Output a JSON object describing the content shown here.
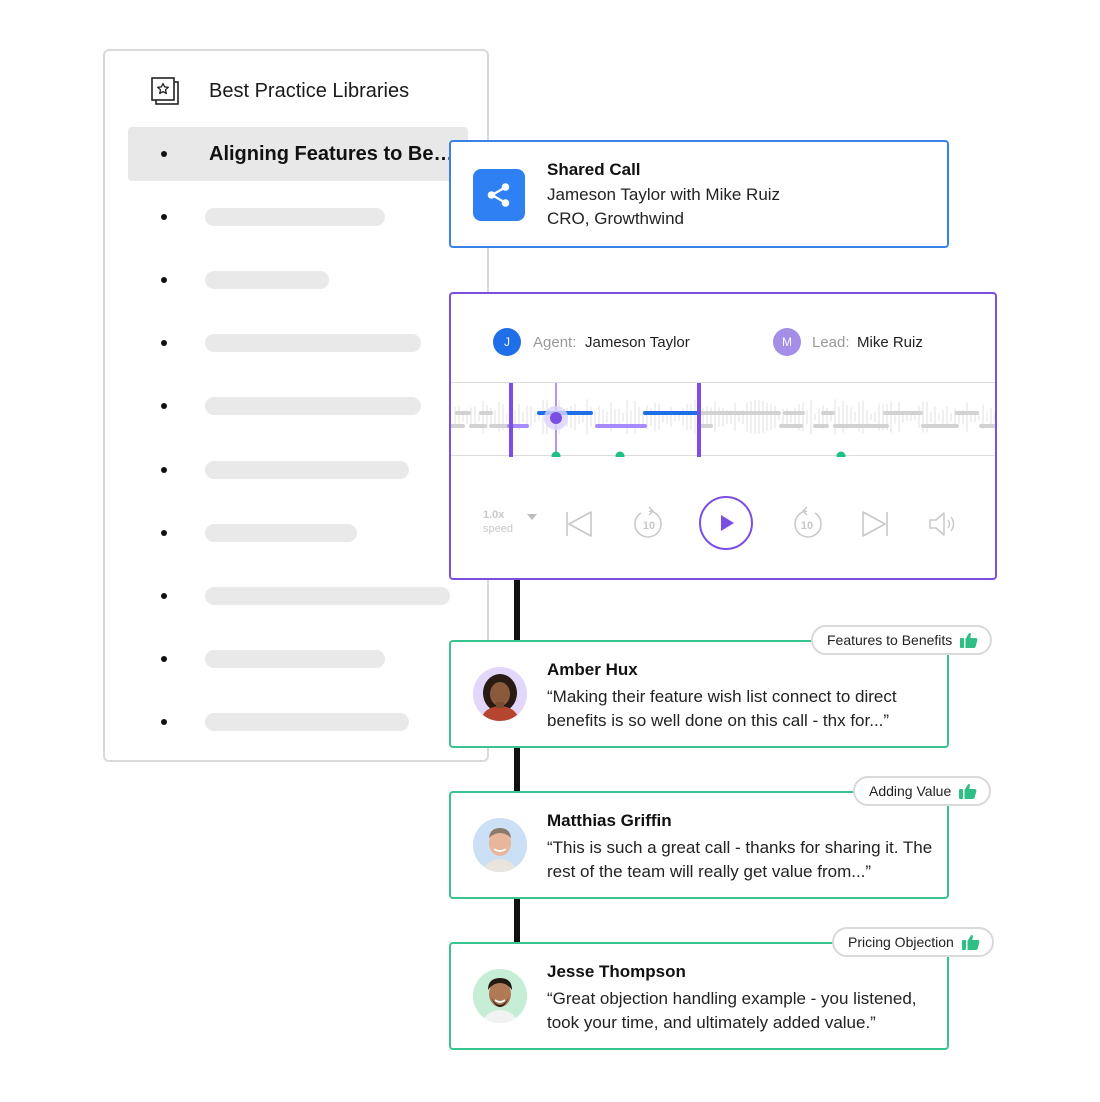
{
  "library": {
    "title": "Best Practice Libraries",
    "icon": "star-card-stack-icon",
    "active_item": "Aligning Features to Benefits"
  },
  "shared_call": {
    "title": "Shared Call",
    "participants": "Jameson Taylor with Mike Ruiz",
    "company": "CRO, Growthwind",
    "icon": "share-icon",
    "accent": "#2f80f2"
  },
  "player": {
    "agent": {
      "label": "Agent:",
      "name": "Jameson Taylor",
      "initial": "J",
      "color": "#1f6fe8"
    },
    "lead": {
      "label": "Lead:",
      "name": "Mike Ruiz",
      "initial": "M",
      "color": "#a58ee8"
    },
    "speed_value": "1.0x",
    "speed_label": "speed",
    "skip_back_seconds": "10",
    "skip_forward_seconds": "10",
    "accent": "#7b4fe3"
  },
  "comments": [
    {
      "name": "Amber Hux",
      "text": "“Making their feature wish list connect to direct benefits is so well done on this call - thx for...”",
      "tag": "Features to Benefits"
    },
    {
      "name": "Matthias Griffin",
      "text": "“This is such  a great call - thanks for sharing it. The rest of the team will really get value from...”",
      "tag": "Adding Value"
    },
    {
      "name": "Jesse Thompson",
      "text": "“Great objection handling example - you listened, took your time, and ultimately added value.”",
      "tag": "Pricing Objection"
    }
  ],
  "colors": {
    "comment_border": "#39c48f",
    "thumb": "#2fbf85",
    "marker": "#1fc285"
  }
}
